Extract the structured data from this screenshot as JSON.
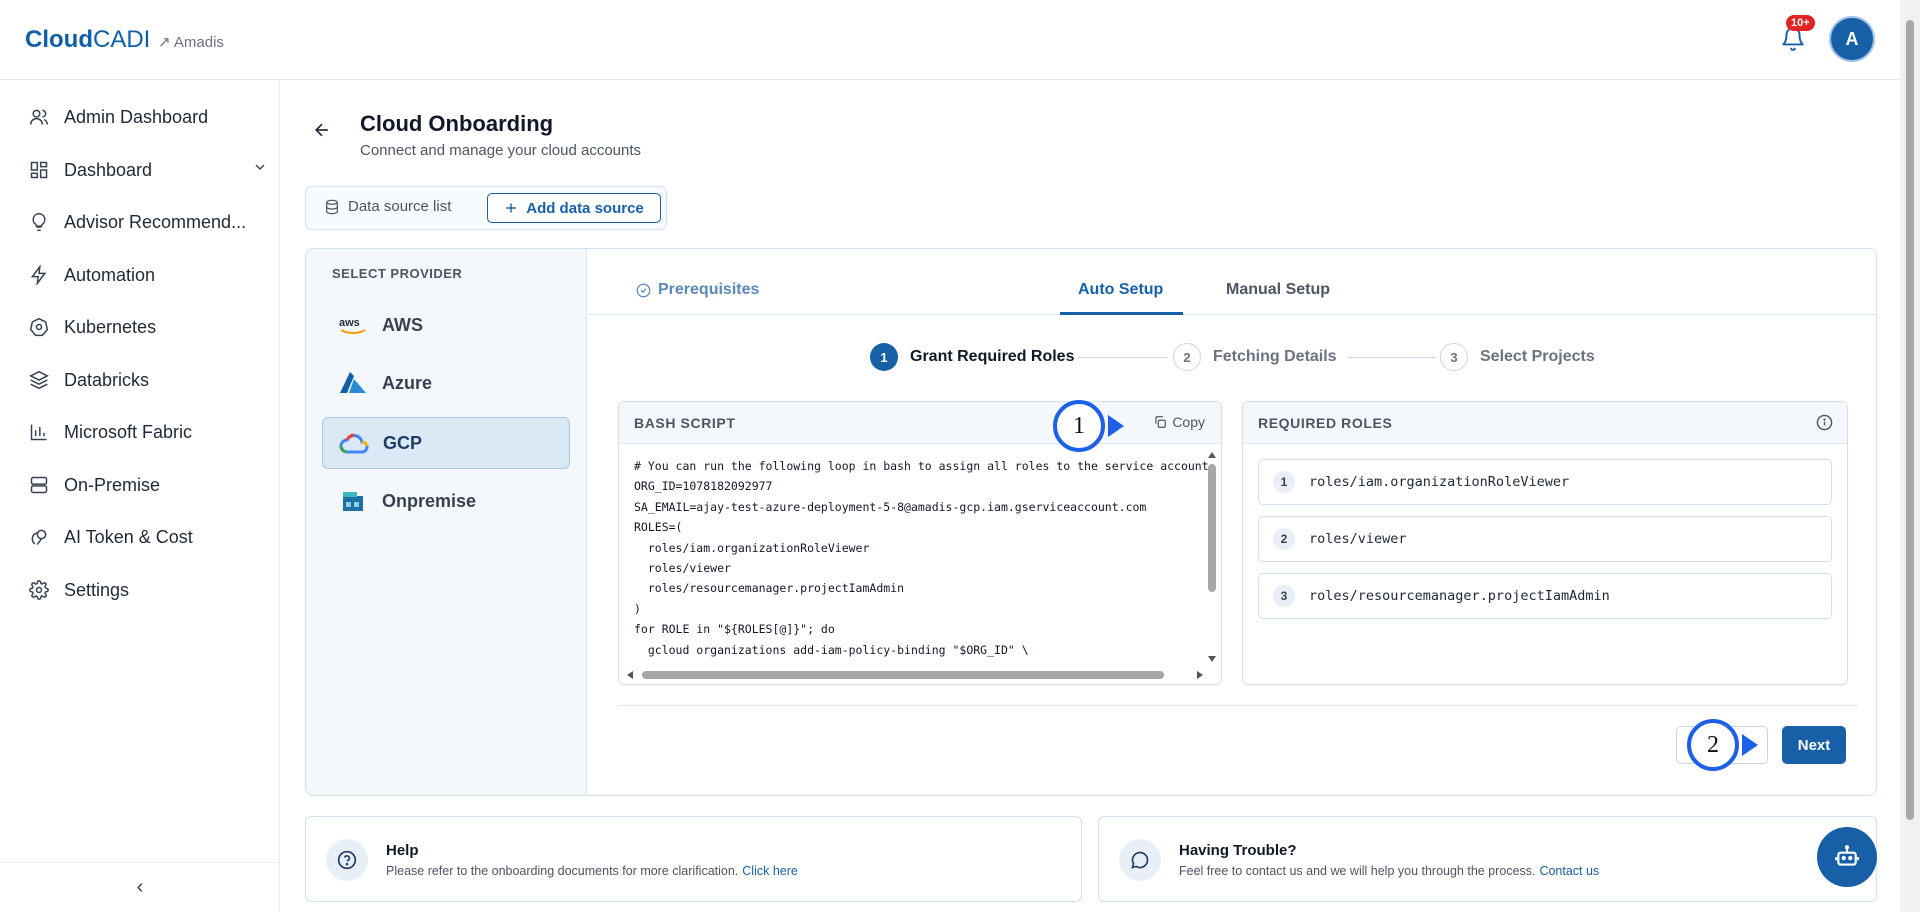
{
  "header": {
    "logo_bold": "Cloud",
    "logo_light": "CADI",
    "tenant": "↗ Amadis",
    "notification_badge": "10+",
    "avatar_initial": "A"
  },
  "sidebar": {
    "items": [
      {
        "label": "Admin Dashboard",
        "icon": "users-icon"
      },
      {
        "label": "Dashboard",
        "icon": "dashboard-icon"
      },
      {
        "label": "Advisor Recommend...",
        "icon": "lightbulb-icon"
      },
      {
        "label": "Automation",
        "icon": "bolt-icon"
      },
      {
        "label": "Kubernetes",
        "icon": "kubernetes-icon"
      },
      {
        "label": "Databricks",
        "icon": "layers-icon"
      },
      {
        "label": "Microsoft Fabric",
        "icon": "bar-chart-icon"
      },
      {
        "label": "On-Premise",
        "icon": "server-icon"
      },
      {
        "label": "AI Token & Cost",
        "icon": "ai-token-icon"
      },
      {
        "label": "Settings",
        "icon": "gear-icon"
      }
    ],
    "collapse_glyph": "‹"
  },
  "page": {
    "title": "Cloud Onboarding",
    "subtitle": "Connect and manage your cloud accounts"
  },
  "toolbar": {
    "datasource_list": "Data source list",
    "add_datasource": "Add data source"
  },
  "providers": {
    "label": "SELECT PROVIDER",
    "items": [
      {
        "label": "AWS"
      },
      {
        "label": "Azure"
      },
      {
        "label": "GCP"
      },
      {
        "label": "Onpremise"
      }
    ],
    "selected": "GCP"
  },
  "tabs": [
    {
      "label": "Prerequisites"
    },
    {
      "label": "Auto Setup"
    },
    {
      "label": "Manual Setup"
    }
  ],
  "steps": [
    {
      "num": "1",
      "label": "Grant Required Roles"
    },
    {
      "num": "2",
      "label": "Fetching Details"
    },
    {
      "num": "3",
      "label": "Select Projects"
    }
  ],
  "bash": {
    "title": "BASH SCRIPT",
    "copy_label": "Copy",
    "script": "# You can run the following loop in bash to assign all roles to the service account\nORG_ID=1078182092977\nSA_EMAIL=ajay-test-azure-deployment-5-8@amadis-gcp.iam.gserviceaccount.com\nROLES=(\n  roles/iam.organizationRoleViewer\n  roles/viewer\n  roles/resourcemanager.projectIamAdmin\n)\nfor ROLE in \"${ROLES[@]}\"; do\n  gcloud organizations add-iam-policy-binding \"$ORG_ID\" \\"
  },
  "roles": {
    "title": "REQUIRED ROLES",
    "items": [
      {
        "num": "1",
        "role": "roles/iam.organizationRoleViewer"
      },
      {
        "num": "2",
        "role": "roles/viewer"
      },
      {
        "num": "3",
        "role": "roles/resourcemanager.projectIamAdmin"
      }
    ]
  },
  "actions": {
    "next": "Next"
  },
  "markers": [
    "1",
    "2"
  ],
  "help": {
    "title": "Help",
    "desc": "Please refer to the onboarding documents for more clarification.",
    "link": "Click here"
  },
  "trouble": {
    "title": "Having Trouble?",
    "desc": "Feel free to contact us and we will help you through the process.",
    "link": "Contact us"
  },
  "colors": {
    "accent": "#1760a8",
    "marker": "#1d5fe6",
    "badge": "#e02424"
  }
}
